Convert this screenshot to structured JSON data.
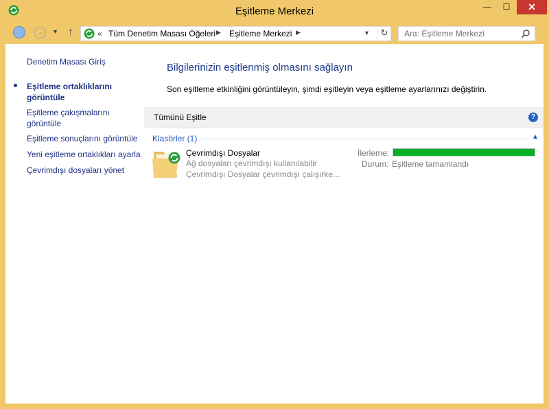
{
  "window": {
    "title": "Eşitleme Merkezi",
    "controls": {
      "minimize": "—",
      "maximize": "☐",
      "close": "✕"
    }
  },
  "address_bar": {
    "overflow": "«",
    "breadcrumbs": [
      "Tüm Denetim Masası Öğeleri",
      "Eşitleme Merkezi"
    ],
    "separator": "▶",
    "refresh": "↻"
  },
  "search": {
    "placeholder": "Ara: Eşitleme Merkezi"
  },
  "sidebar": {
    "items": [
      {
        "label": "Denetim Masası Giriş"
      },
      {
        "label": "Eşitleme ortaklıklarını görüntüle",
        "active": true
      },
      {
        "label": "Eşitleme çakışmalarını görüntüle"
      },
      {
        "label": "Eşitleme sonuçlarını görüntüle"
      },
      {
        "label": "Yeni eşitleme ortaklıkları ayarla"
      },
      {
        "label": "Çevrimdışı dosyaları yönet"
      }
    ]
  },
  "main": {
    "heading": "Bilgilerinizin eşitlenmiş olmasını sağlayın",
    "description": "Son eşitleme etkinliğini görüntüleyin, şimdi eşitleyin veya eşitleme ayarlarınızı değiştirin.",
    "toolbar": {
      "sync_all": "Tümünü Eşitle",
      "help": "?"
    },
    "group": {
      "label": "Klasörler (1)",
      "toggle": "▲"
    },
    "item": {
      "title": "Çevrimdışı Dosyalar",
      "line1": "Ağ dosyaları çevrimdışı kullanılabilir",
      "line2": "Çevrimdışı Dosyalar çevrimdışı çalışırke...",
      "progress_label": "İlerleme:",
      "progress_percent": 100,
      "status_label": "Durum:",
      "status_value": "Eşitleme tamamlandı"
    }
  },
  "colors": {
    "frame": "#f0c869",
    "link": "#1e3287",
    "heading": "#1e3a8f",
    "progress": "#06b025",
    "close": "#c7372f"
  }
}
